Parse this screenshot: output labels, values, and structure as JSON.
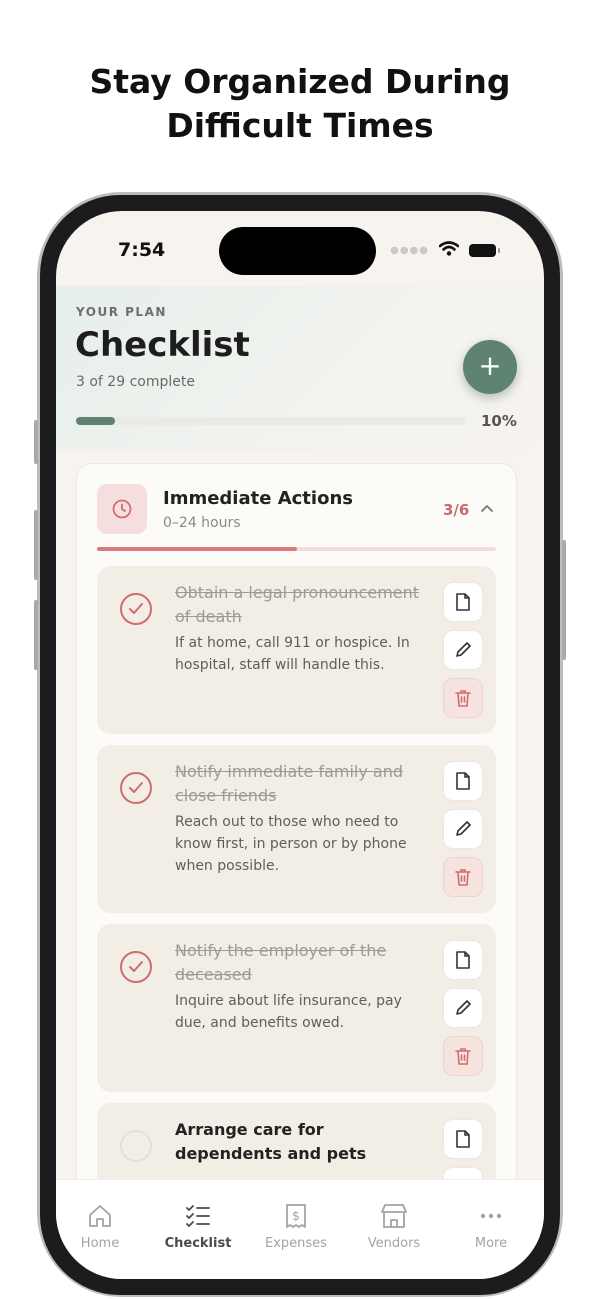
{
  "promo": {
    "headline_line1": "Stay Organized During",
    "headline_line2": "Difficult Times"
  },
  "status_bar": {
    "time": "7:54",
    "icons": [
      "signal-dots-icon",
      "wifi-icon",
      "battery-icon"
    ]
  },
  "header": {
    "eyebrow": "YOUR PLAN",
    "title": "Checklist",
    "subtitle": "3 of 29 complete",
    "progress_percent": 10,
    "progress_label": "10%",
    "add_button_icon": "plus-icon"
  },
  "section": {
    "title": "Immediate Actions",
    "subtitle": "0–24 hours",
    "count": "3/6",
    "progress_fraction": 0.5,
    "icon": "clock-icon",
    "accent_color": "#d06d6d"
  },
  "tasks": [
    {
      "title": "Obtain a legal pronouncement of death",
      "description": "If at home, call 911 or hospice. In hospital, staff will handle this.",
      "done": true
    },
    {
      "title": "Notify immediate family and close friends",
      "description": "Reach out to those who need to know first, in person or by phone when possible.",
      "done": true
    },
    {
      "title": "Notify the employer of the deceased",
      "description": "Inquire about life insurance, pay due, and benefits owed.",
      "done": true
    },
    {
      "title": "Arrange care for dependents and pets",
      "description": "",
      "done": false
    }
  ],
  "tabs": [
    {
      "label": "Home",
      "icon": "home-icon",
      "active": false
    },
    {
      "label": "Checklist",
      "icon": "checklist-icon",
      "active": true
    },
    {
      "label": "Expenses",
      "icon": "receipt-icon",
      "active": false
    },
    {
      "label": "Vendors",
      "icon": "store-icon",
      "active": false
    },
    {
      "label": "More",
      "icon": "more-dots-icon",
      "active": false
    }
  ],
  "colors": {
    "brand_green": "#5e8373",
    "accent_red": "#d06d6d",
    "background": "#f7f3ee"
  }
}
